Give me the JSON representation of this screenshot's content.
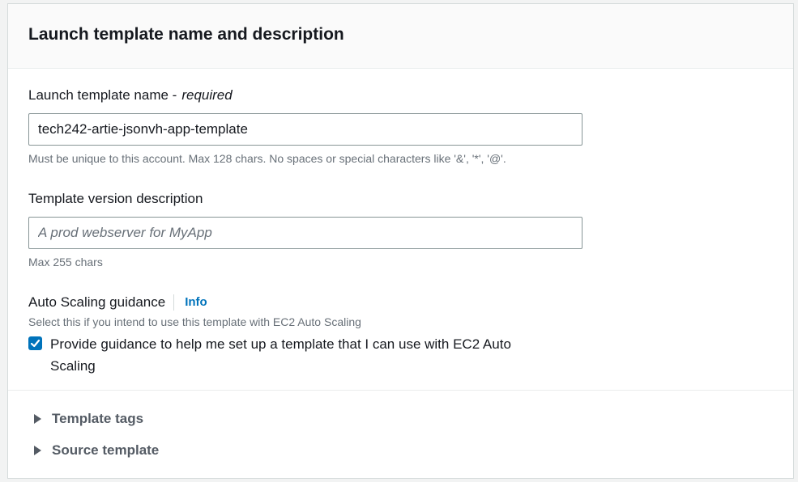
{
  "section": {
    "title": "Launch template name and description"
  },
  "name_field": {
    "label": "Launch template name -",
    "label_suffix": "required",
    "value": "tech242-artie-jsonvh-app-template",
    "hint": "Must be unique to this account. Max 128 chars. No spaces or special characters like '&', '*', '@'."
  },
  "description_field": {
    "label": "Template version description",
    "placeholder": "A prod webserver for MyApp",
    "value": "",
    "hint": "Max 255 chars"
  },
  "auto_scaling": {
    "label": "Auto Scaling guidance",
    "info_link": "Info",
    "hint": "Select this if you intend to use this template with EC2 Auto Scaling",
    "checkbox_label": "Provide guidance to help me set up a template that I can use with EC2 Auto Scaling",
    "checked": true
  },
  "expanders": [
    {
      "label": "Template tags",
      "expanded": false
    },
    {
      "label": "Source template",
      "expanded": false
    }
  ],
  "colors": {
    "accent": "#0073bb",
    "text": "#16191f",
    "muted": "#687078",
    "border": "#879596"
  }
}
